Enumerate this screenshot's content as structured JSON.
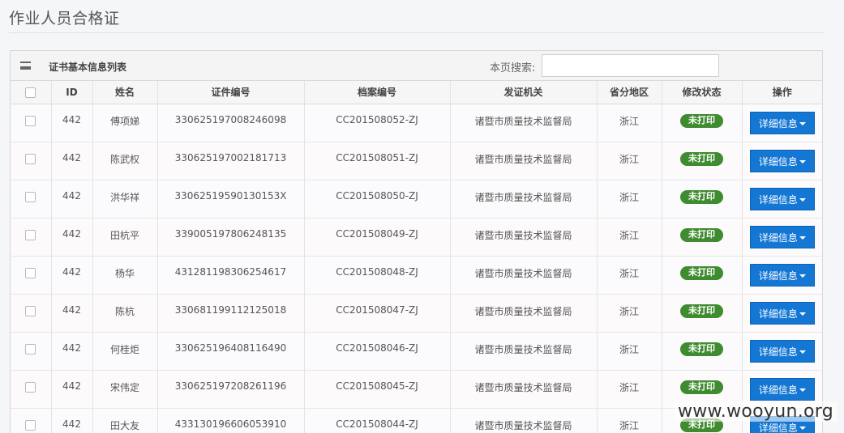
{
  "page_title": "作业人员合格证",
  "panel": {
    "title": "证书基本信息列表",
    "search_label": "本页搜索:",
    "search_value": ""
  },
  "columns": [
    "ID",
    "姓名",
    "证件编号",
    "档案编号",
    "发证机关",
    "省分地区",
    "修改状态",
    "操作"
  ],
  "rows": [
    {
      "id": "442",
      "name": "傅项娣",
      "cert_no": "330625197008246098",
      "file_no": "CC201508052-ZJ",
      "authority": "诸暨市质量技术监督局",
      "region": "浙江",
      "status": "未打印",
      "action": "详细信息"
    },
    {
      "id": "442",
      "name": "陈武权",
      "cert_no": "330625197002181713",
      "file_no": "CC201508051-ZJ",
      "authority": "诸暨市质量技术监督局",
      "region": "浙江",
      "status": "未打印",
      "action": "详细信息"
    },
    {
      "id": "442",
      "name": "洪华祥",
      "cert_no": "33062519590130153X",
      "file_no": "CC201508050-ZJ",
      "authority": "诸暨市质量技术监督局",
      "region": "浙江",
      "status": "未打印",
      "action": "详细信息"
    },
    {
      "id": "442",
      "name": "田杭平",
      "cert_no": "339005197806248135",
      "file_no": "CC201508049-ZJ",
      "authority": "诸暨市质量技术监督局",
      "region": "浙江",
      "status": "未打印",
      "action": "详细信息"
    },
    {
      "id": "442",
      "name": "杨华",
      "cert_no": "431281198306254617",
      "file_no": "CC201508048-ZJ",
      "authority": "诸暨市质量技术监督局",
      "region": "浙江",
      "status": "未打印",
      "action": "详细信息"
    },
    {
      "id": "442",
      "name": "陈杭",
      "cert_no": "330681199112125018",
      "file_no": "CC201508047-ZJ",
      "authority": "诸暨市质量技术监督局",
      "region": "浙江",
      "status": "未打印",
      "action": "详细信息"
    },
    {
      "id": "442",
      "name": "何桂炬",
      "cert_no": "330625196408116490",
      "file_no": "CC201508046-ZJ",
      "authority": "诸暨市质量技术监督局",
      "region": "浙江",
      "status": "未打印",
      "action": "详细信息"
    },
    {
      "id": "442",
      "name": "宋伟定",
      "cert_no": "330625197208261196",
      "file_no": "CC201508045-ZJ",
      "authority": "诸暨市质量技术监督局",
      "region": "浙江",
      "status": "未打印",
      "action": "详细信息"
    },
    {
      "id": "442",
      "name": "田大友",
      "cert_no": "433130196606053910",
      "file_no": "CC201508044-ZJ",
      "authority": "诸暨市质量技术监督局",
      "region": "浙江",
      "status": "未打印",
      "action": "详细信息"
    }
  ],
  "watermark": "www.wooyun.org",
  "colors": {
    "status_badge": "#3f8b2f",
    "action_button": "#1477d4"
  }
}
